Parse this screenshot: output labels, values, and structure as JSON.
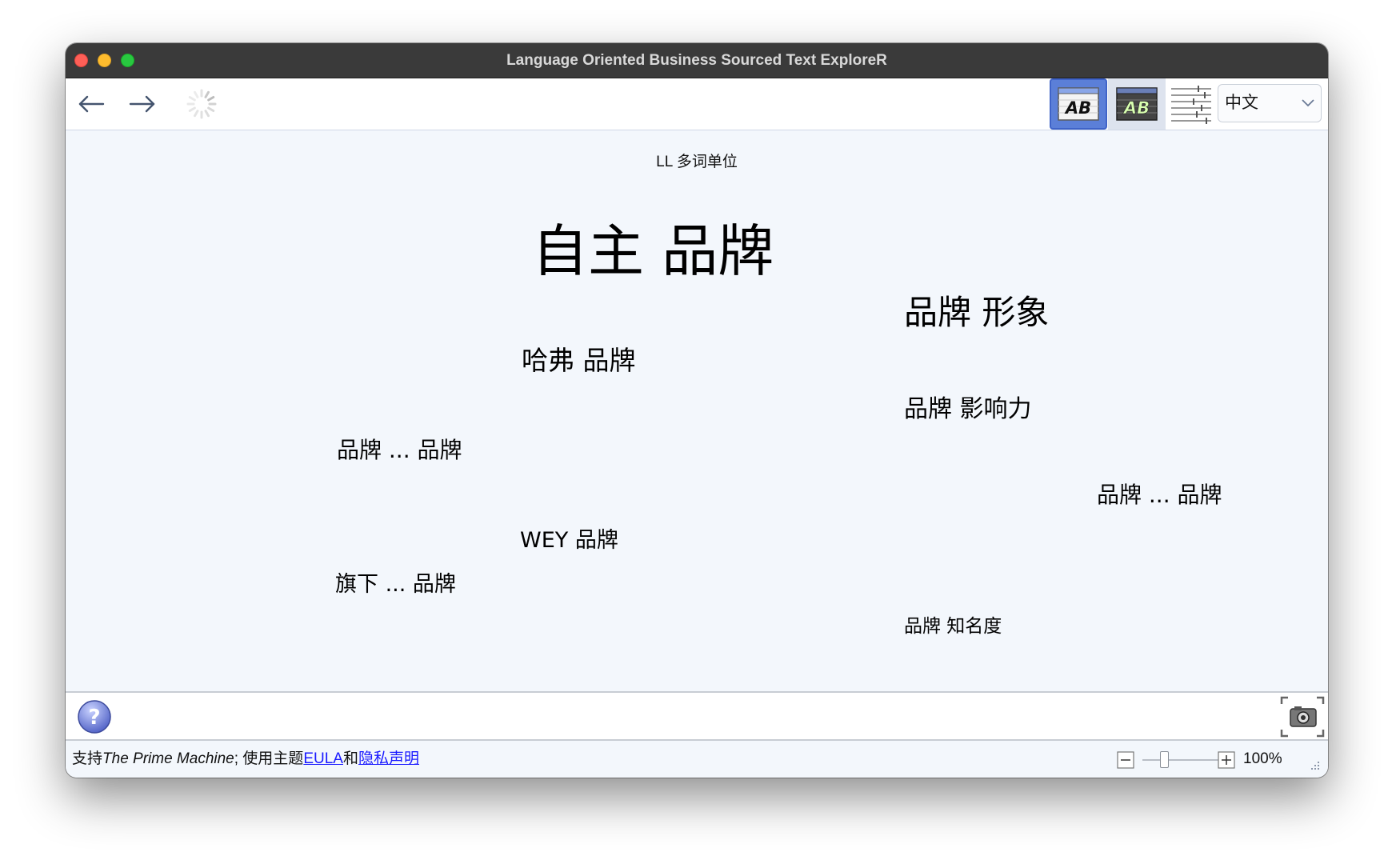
{
  "window": {
    "title": "Language Oriented Business Sourced Text ExploreR"
  },
  "toolbar": {
    "language": "中文"
  },
  "cloud": {
    "heading": "LL 多词单位",
    "terms": [
      {
        "text": "自主 品牌"
      },
      {
        "text": "品牌 形象"
      },
      {
        "text": "哈弗 品牌"
      },
      {
        "text": "品牌 影响力"
      },
      {
        "text": "品牌 ... 品牌"
      },
      {
        "text": "品牌 ... 品牌"
      },
      {
        "text": "WEY 品牌"
      },
      {
        "text": "旗下 ... 品牌"
      },
      {
        "text": "品牌 知名度"
      }
    ]
  },
  "status": {
    "prefix": "支持",
    "product": "The Prime Machine",
    "middle": "; 使用主题",
    "eula": "EULA",
    "and": "和",
    "privacy": "隐私声明",
    "zoom": "100%"
  },
  "colors": {
    "accent": "#5b7fd8",
    "link": "#1a1aff",
    "background": "#f3f7fc"
  }
}
